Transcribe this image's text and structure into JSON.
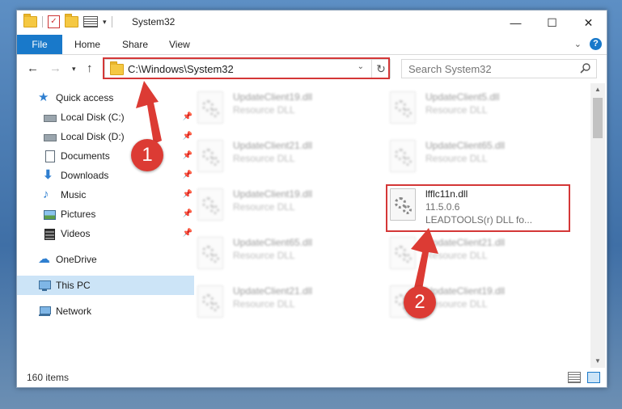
{
  "window": {
    "title": "System32",
    "controls": {
      "minimize": "—",
      "maximize": "☐",
      "close": "✕"
    }
  },
  "ribbon": {
    "tabs": [
      {
        "label": "File"
      },
      {
        "label": "Home"
      },
      {
        "label": "Share"
      },
      {
        "label": "View"
      }
    ]
  },
  "address": {
    "path": "C:\\Windows\\System32",
    "search_placeholder": "Search System32"
  },
  "sidebar": {
    "items": [
      {
        "label": "Quick access"
      },
      {
        "label": "Local Disk (C:)"
      },
      {
        "label": "Local Disk (D:)"
      },
      {
        "label": "Documents"
      },
      {
        "label": "Downloads"
      },
      {
        "label": "Music"
      },
      {
        "label": "Pictures"
      },
      {
        "label": "Videos"
      },
      {
        "label": "OneDrive"
      },
      {
        "label": "This PC"
      },
      {
        "label": "Network"
      }
    ]
  },
  "files": [
    {
      "name": "UpdateClient19.dll",
      "desc": "Resource DLL"
    },
    {
      "name": "UpdateClient5.dll",
      "desc": "Resource DLL"
    },
    {
      "name": "UpdateClient21.dll",
      "desc": "Resource DLL"
    },
    {
      "name": "UpdateClient65.dll",
      "desc": "Resource DLL"
    },
    {
      "name": "UpdateClient19.dll",
      "desc": "Resource DLL"
    },
    {
      "name": "UpdateClient65.dll",
      "desc": "Resource DLL"
    },
    {
      "name": "UpdateClient21.dll",
      "desc": "Resource DLL"
    },
    {
      "name": "UpdateClient21.dll",
      "desc": "Resource DLL"
    },
    {
      "name": "UpdateClient19.dll",
      "desc": "Resource DLL"
    }
  ],
  "highlighted_file": {
    "name": "lfflc11n.dll",
    "version": "11.5.0.6",
    "desc": "LEADTOOLS(r) DLL fo..."
  },
  "status": {
    "item_count": "160 items"
  },
  "annotations": {
    "step1": "1",
    "step2": "2"
  },
  "colors": {
    "accent": "#1979ca",
    "highlight_red": "#d43737",
    "badge_red": "#dc3b34",
    "selected": "#cce4f7"
  }
}
